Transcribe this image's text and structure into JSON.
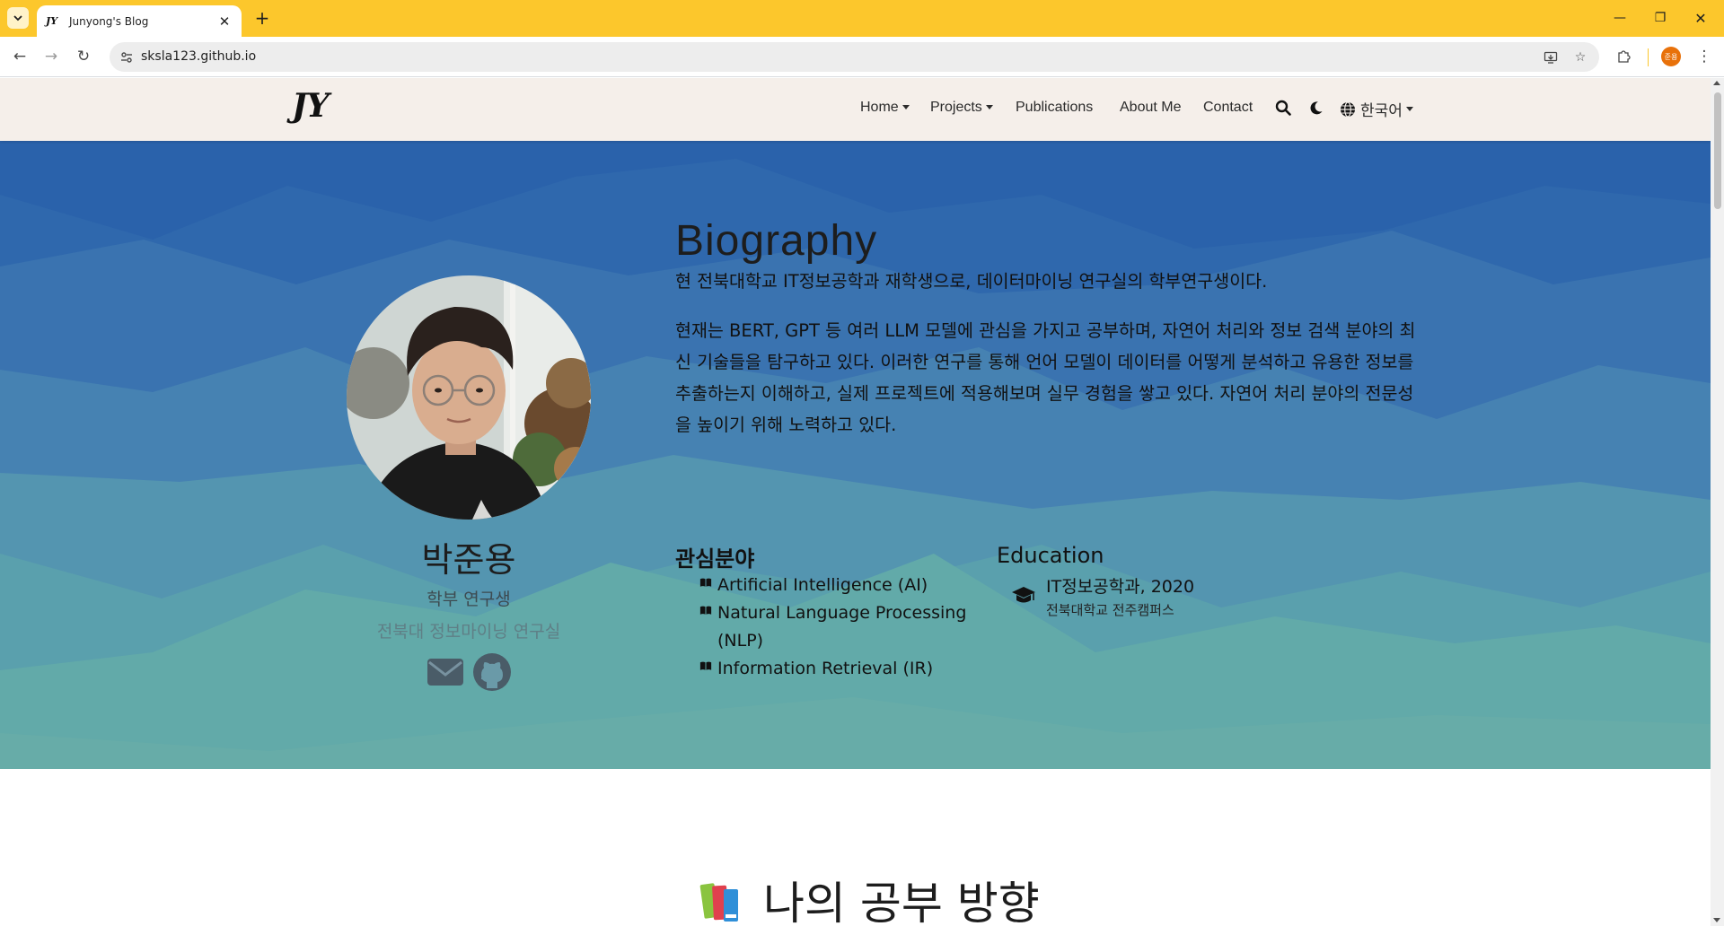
{
  "browser": {
    "tab_title": "Junyong's Blog",
    "tab_favicon": "JY",
    "url": "sksla123.github.io",
    "profile_initials": "준용"
  },
  "nav": {
    "brand": "JY",
    "items": [
      {
        "label": "Home",
        "dropdown": true
      },
      {
        "label": "Projects",
        "dropdown": true
      },
      {
        "label": "Publications",
        "dropdown": false
      },
      {
        "label": "About Me",
        "dropdown": false
      },
      {
        "label": "Contact",
        "dropdown": false
      }
    ],
    "language": "한국어",
    "icons": [
      "search-icon",
      "moon-icon",
      "globe-icon"
    ]
  },
  "profile": {
    "name": "박준용",
    "role": "학부 연구생",
    "lab": "전북대 정보마이닝 연구실",
    "social_icons": [
      "envelope-icon",
      "github-icon"
    ]
  },
  "bio": {
    "title": "Biography",
    "paragraph1": "현 전북대학교 IT정보공학과 재학생으로, 데이터마이닝 연구실의 학부연구생이다.",
    "paragraph2": "현재는 BERT, GPT 등 여러 LLM 모델에 관심을 가지고 공부하며, 자연어 처리와 정보 검색 분야의 최신 기술들을 탐구하고 있다. 이러한 연구를 통해 언어 모델이 데이터를 어떻게 분석하고 유용한 정보를 추출하는지 이해하고, 실제 프로젝트에 적용해보며 실무 경험을 쌓고 있다. 자연어 처리 분야의 전문성을 높이기 위해 노력하고 있다."
  },
  "interests": {
    "heading": "관심분야",
    "items": [
      "Artificial Intelligence (AI)",
      "Natural Language Processing (NLP)",
      "Information Retrieval (IR)"
    ]
  },
  "education": {
    "heading": "Education",
    "degree": "IT정보공학과, 2020",
    "school": "전북대학교 전주캠퍼스"
  },
  "study": {
    "title": "나의 공부 방향"
  },
  "colors": {
    "browser_frame": "#fcc72c",
    "navbar_bg": "#f5efea",
    "hero_top": "#2a62ab",
    "hero_mid": "#4a86b2",
    "hero_bottom": "#67aca8"
  }
}
